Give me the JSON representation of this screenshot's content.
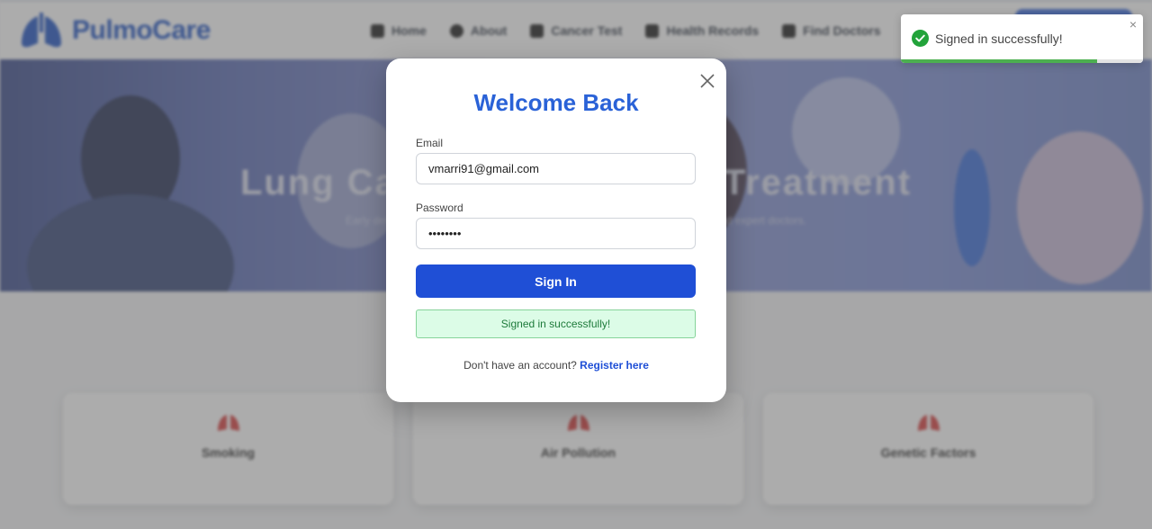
{
  "navbar": {
    "brand": "PulmoCare",
    "links": [
      {
        "label": "Home",
        "icon": "home-icon"
      },
      {
        "label": "About",
        "icon": "info-icon"
      },
      {
        "label": "Cancer Test",
        "icon": "syringe-icon"
      },
      {
        "label": "Health Records",
        "icon": "file-icon"
      },
      {
        "label": "Find Doctors",
        "icon": "user-doctor-icon"
      }
    ]
  },
  "hero": {
    "title": "Lung Cancer Detection & Treatment",
    "subtitle": "Early detection saves lives. Take advantage of our advanced screening tools and expert doctors."
  },
  "cards": [
    {
      "label": "Smoking"
    },
    {
      "label": "Air Pollution"
    },
    {
      "label": "Genetic Factors"
    }
  ],
  "modal": {
    "title": "Welcome Back",
    "email_label": "Email",
    "email_value": "vmarri91@gmail.com",
    "password_label": "Password",
    "password_value": "password",
    "signin_label": "Sign In",
    "success_message": "Signed in successfully!",
    "register_prompt": "Don't have an account?",
    "register_link": "Register here"
  },
  "toast": {
    "message": "Signed in successfully!",
    "close_symbol": "×",
    "progress": 0.81
  },
  "colors": {
    "brand": "#2457c5",
    "primary_button": "#1f4fd6",
    "success_bg": "#dcfce7",
    "success_text": "#1d7a3a",
    "toast_check": "#22a33a"
  }
}
